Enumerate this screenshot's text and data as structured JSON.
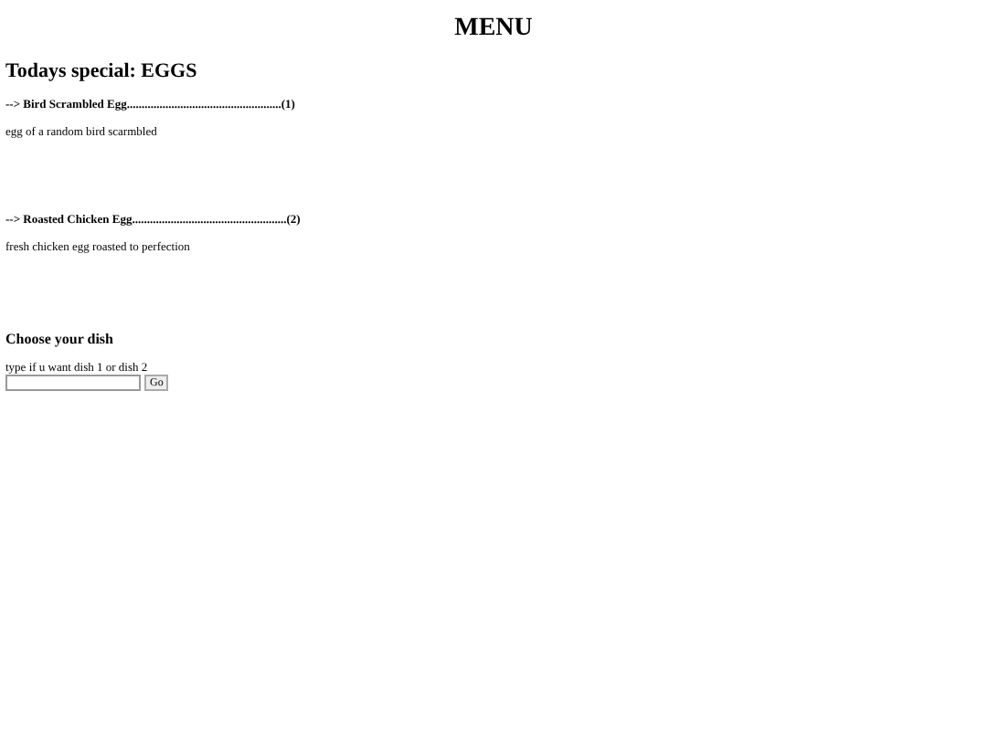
{
  "title": "MENU",
  "special": "Todays special: EGGS",
  "dishes": [
    {
      "name": "--> Bird Scrambled Egg....................................................(1)",
      "description": "egg of a random bird scarmbled"
    },
    {
      "name": "--> Roasted Chicken Egg....................................................(2)",
      "description": "fresh chicken egg roasted to perfection"
    }
  ],
  "choose": {
    "heading": "Choose your dish",
    "prompt": "type if u want dish 1 or dish 2",
    "button": "Go"
  }
}
